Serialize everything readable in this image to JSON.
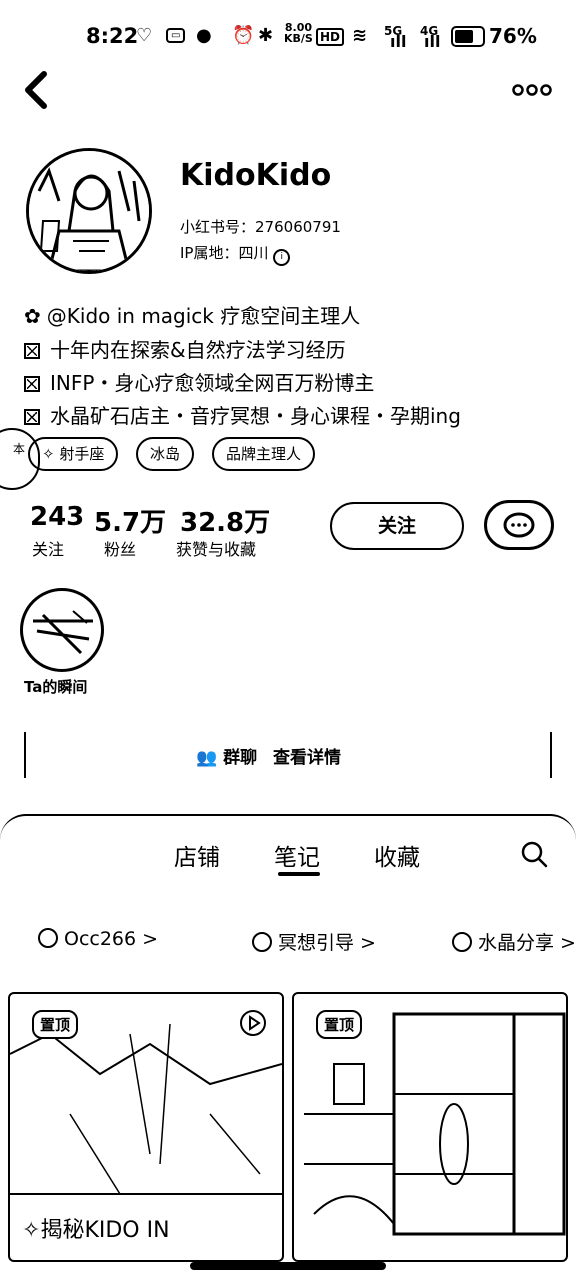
{
  "status": {
    "time": "8:22",
    "speed_value": "8.00",
    "speed_unit": "KB/S",
    "hd": "HD",
    "signal1": "5G",
    "signal2": "4G",
    "battery": "76%"
  },
  "profile": {
    "name": "KidoKido",
    "id_label": "小红书号：",
    "id_value": "276060791",
    "ip_label": "IP属地：",
    "ip_value": "四川",
    "bio": [
      "@Kido in magick 疗愈空间主理人",
      "十年内在探索&自然疗法学习经历",
      "INFP・身心疗愈领域全网百万粉博主",
      "水晶矿石店主・音疗冥想・身心课程・孕期ing"
    ],
    "tags": [
      "射手座",
      "冰岛",
      "品牌主理人"
    ],
    "side_label": "本"
  },
  "stats": [
    {
      "value": "243",
      "label": "关注"
    },
    {
      "value": "5.7万",
      "label": "粉丝"
    },
    {
      "value": "32.8万",
      "label": "获赞与收藏"
    }
  ],
  "actions": {
    "follow": "关注"
  },
  "moment": {
    "label": "Ta的瞬间"
  },
  "group": {
    "text": "群聊",
    "detail": "查看详情"
  },
  "tabs": [
    "店铺",
    "笔记",
    "收藏"
  ],
  "active_tab": "笔记",
  "collections": [
    "Occ266 >",
    "冥想引导 >",
    "水晶分享 >"
  ],
  "cards": [
    {
      "pin": "置顶",
      "title": "揭秘KIDO IN"
    },
    {
      "pin": "置顶",
      "title": ""
    }
  ]
}
